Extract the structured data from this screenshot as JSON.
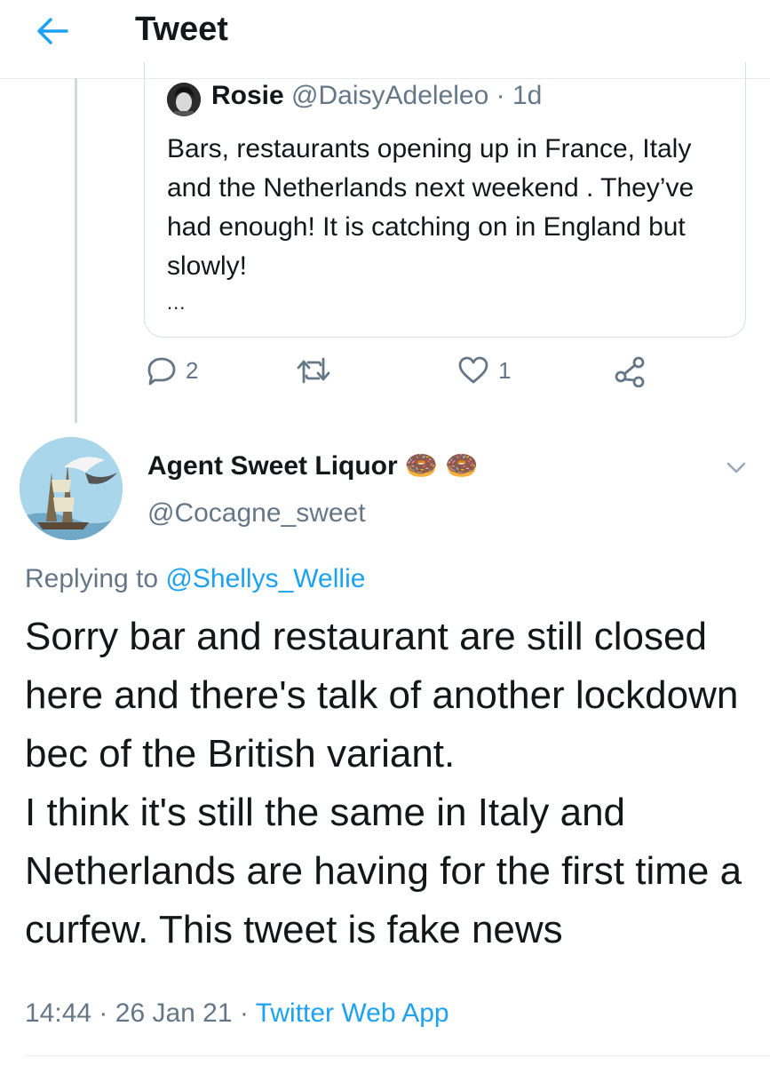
{
  "header": {
    "title": "Tweet",
    "back_icon": "arrow-left-icon",
    "accent": "#1da1f2"
  },
  "quoted_tweet": {
    "name": "Rosie",
    "handle": "@DaisyAdeleleo",
    "separator": "·",
    "time": "1d",
    "text": "Bars, restaurants opening up in France, Italy and the Netherlands next weekend . They’ve had enough! It is catching on in England but slowly!",
    "more": "..."
  },
  "actions": {
    "reply_count": "2",
    "retweet_count": "",
    "like_count": "1",
    "icons": [
      "reply-icon",
      "retweet-icon",
      "like-icon",
      "share-icon"
    ]
  },
  "tweet": {
    "name": "Agent Sweet Liquor",
    "name_emoji": [
      "🍩",
      "🍩"
    ],
    "handle": "@Cocagne_sweet",
    "replying_prefix": "Replying to",
    "replying_user": "@Shellys_Wellie",
    "text": "Sorry bar and restaurant are still closed here and there's talk of another lockdown bec of the British variant.\nI think it's still the same in Italy and Netherlands are having for the first time a curfew. This tweet is fake news",
    "time": "14:44",
    "sep1": "·",
    "date": "26 Jan 21",
    "sep2": "·",
    "source": "Twitter Web App"
  },
  "colors": {
    "text": "#14171a",
    "secondary": "#657786",
    "link": "#1da1f2",
    "border": "#e6ecf0"
  }
}
